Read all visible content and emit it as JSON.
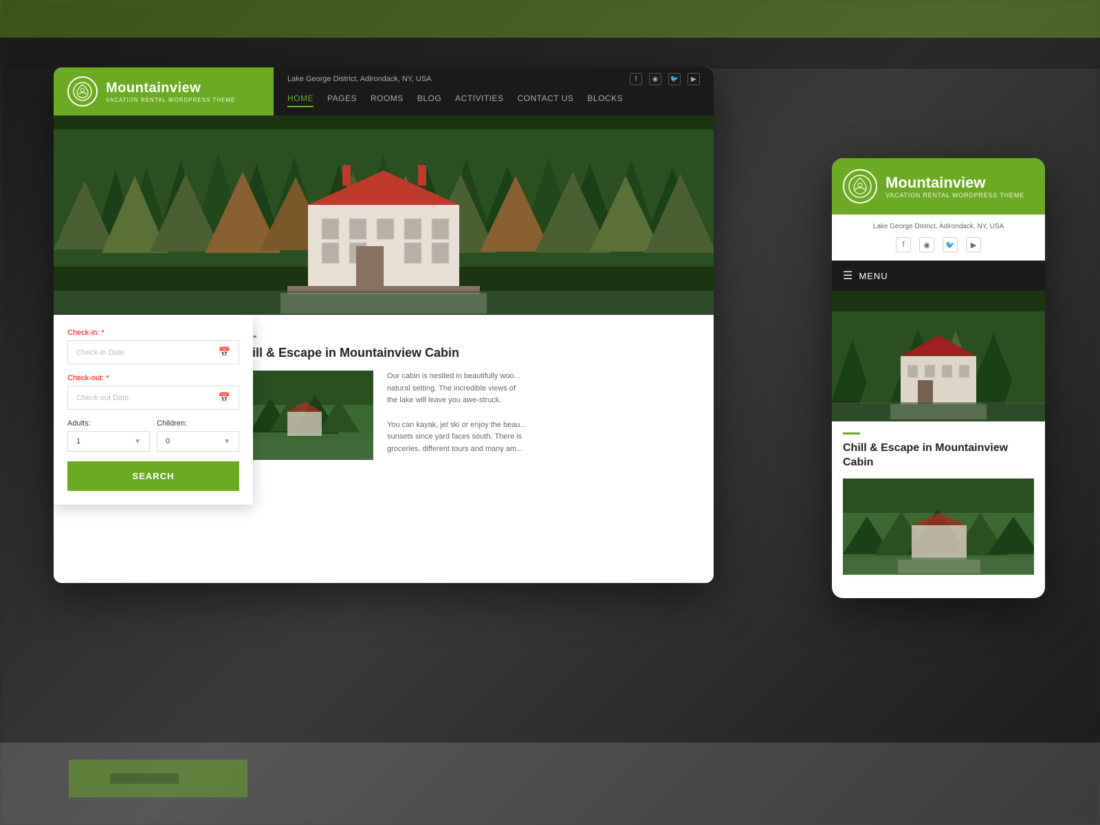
{
  "background": {
    "color": "#2a2a2a"
  },
  "desktop": {
    "logo": {
      "title": "Mountainview",
      "subtitle": "VACATION RENTAL WORDPRESS THEME",
      "icon": "⌂"
    },
    "topbar": {
      "location": "Lake George District, Adirondack, NY, USA",
      "social": {
        "facebook": "f",
        "instagram": "📷",
        "twitter": "🐦",
        "youtube": "▶"
      }
    },
    "nav": {
      "items": [
        {
          "label": "HOME",
          "active": true
        },
        {
          "label": "PAGES",
          "active": false
        },
        {
          "label": "ROOMS",
          "active": false
        },
        {
          "label": "BLOG",
          "active": false
        },
        {
          "label": "ACTIVITIES",
          "active": false
        },
        {
          "label": "CONTACT US",
          "active": false
        },
        {
          "label": "BLOCKS",
          "active": false
        }
      ]
    },
    "content": {
      "divider_color": "#6aab23",
      "title": "Chill & Escape in Mountainview Cabin",
      "description1": "Our cabin is nestled in beautifully woo...",
      "description2": "natural setting. The incredible views of",
      "description3": "the lake will leave you awe-struck.",
      "description4": "You can kayak, jet ski or enjoy the beau...",
      "description5": "sunsets since yard faces south. There is",
      "description6": "groceries, different tours and many am..."
    }
  },
  "booking_form": {
    "checkin_label": "Check-in:",
    "checkin_required": "*",
    "checkin_placeholder": "Check-in Date",
    "checkout_label": "Check-out:",
    "checkout_required": "*",
    "checkout_placeholder": "Check-out Date",
    "adults_label": "Adults:",
    "adults_value": "1",
    "children_label": "Children:",
    "children_value": "0",
    "search_button": "SEARCH"
  },
  "mobile": {
    "logo": {
      "title": "Mountainview",
      "subtitle": "VACATION RENTAL WORDPRESS THEME",
      "icon": "⌂"
    },
    "location": "Lake George District, Adirondack, NY, USA",
    "menu_label": "MENU",
    "social": {
      "facebook": "f",
      "instagram": "📷",
      "twitter": "🐦",
      "youtube": "▶"
    },
    "content": {
      "title": "Chill & Escape in Mountainview Cabin"
    }
  }
}
